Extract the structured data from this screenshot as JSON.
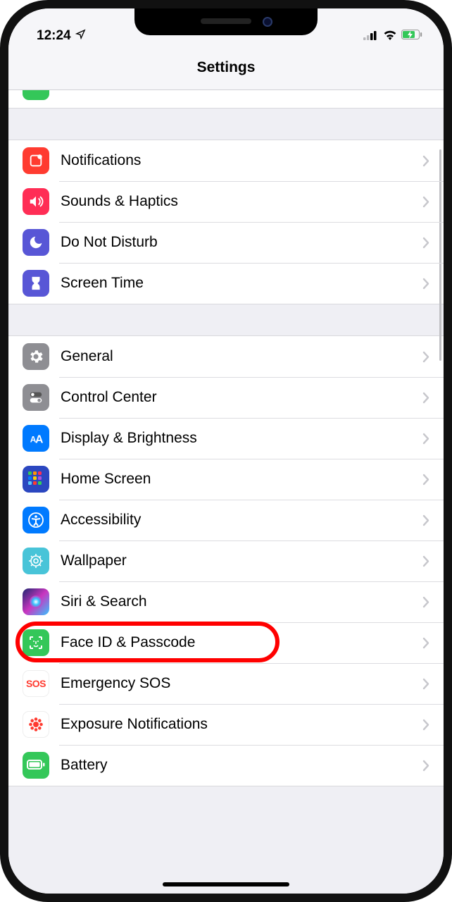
{
  "status": {
    "time": "12:24",
    "location_icon": "location-arrow-icon",
    "signal_icon": "cellular-signal-icon",
    "wifi_icon": "wifi-icon",
    "battery_icon": "battery-charging-icon"
  },
  "header": {
    "title": "Settings"
  },
  "partial_row": {
    "icon_name": "airplane-mode-icon"
  },
  "sections": [
    {
      "items": [
        {
          "icon": "notifications-icon",
          "icon_class": "ic-notifications",
          "label": "Notifications"
        },
        {
          "icon": "sounds-icon",
          "icon_class": "ic-sounds",
          "label": "Sounds & Haptics"
        },
        {
          "icon": "dnd-icon",
          "icon_class": "ic-dnd",
          "label": "Do Not Disturb"
        },
        {
          "icon": "screentime-icon",
          "icon_class": "ic-screentime",
          "label": "Screen Time"
        }
      ]
    },
    {
      "items": [
        {
          "icon": "general-icon",
          "icon_class": "ic-general",
          "label": "General"
        },
        {
          "icon": "controlcenter-icon",
          "icon_class": "ic-controlcenter",
          "label": "Control Center"
        },
        {
          "icon": "display-icon",
          "icon_class": "ic-display",
          "label": "Display & Brightness"
        },
        {
          "icon": "homescreen-icon",
          "icon_class": "ic-homescreen",
          "label": "Home Screen"
        },
        {
          "icon": "accessibility-icon",
          "icon_class": "ic-accessibility",
          "label": "Accessibility"
        },
        {
          "icon": "wallpaper-icon",
          "icon_class": "ic-wallpaper",
          "label": "Wallpaper"
        },
        {
          "icon": "siri-icon",
          "icon_class": "ic-siri",
          "label": "Siri & Search"
        },
        {
          "icon": "faceid-icon",
          "icon_class": "ic-faceid",
          "label": "Face ID & Passcode",
          "highlight": true
        },
        {
          "icon": "sos-icon",
          "icon_class": "ic-sos",
          "label": "Emergency SOS",
          "icon_text": "SOS"
        },
        {
          "icon": "exposure-icon",
          "icon_class": "ic-exposure",
          "label": "Exposure Notifications"
        },
        {
          "icon": "battery-icon",
          "icon_class": "ic-battery",
          "label": "Battery"
        }
      ]
    }
  ]
}
